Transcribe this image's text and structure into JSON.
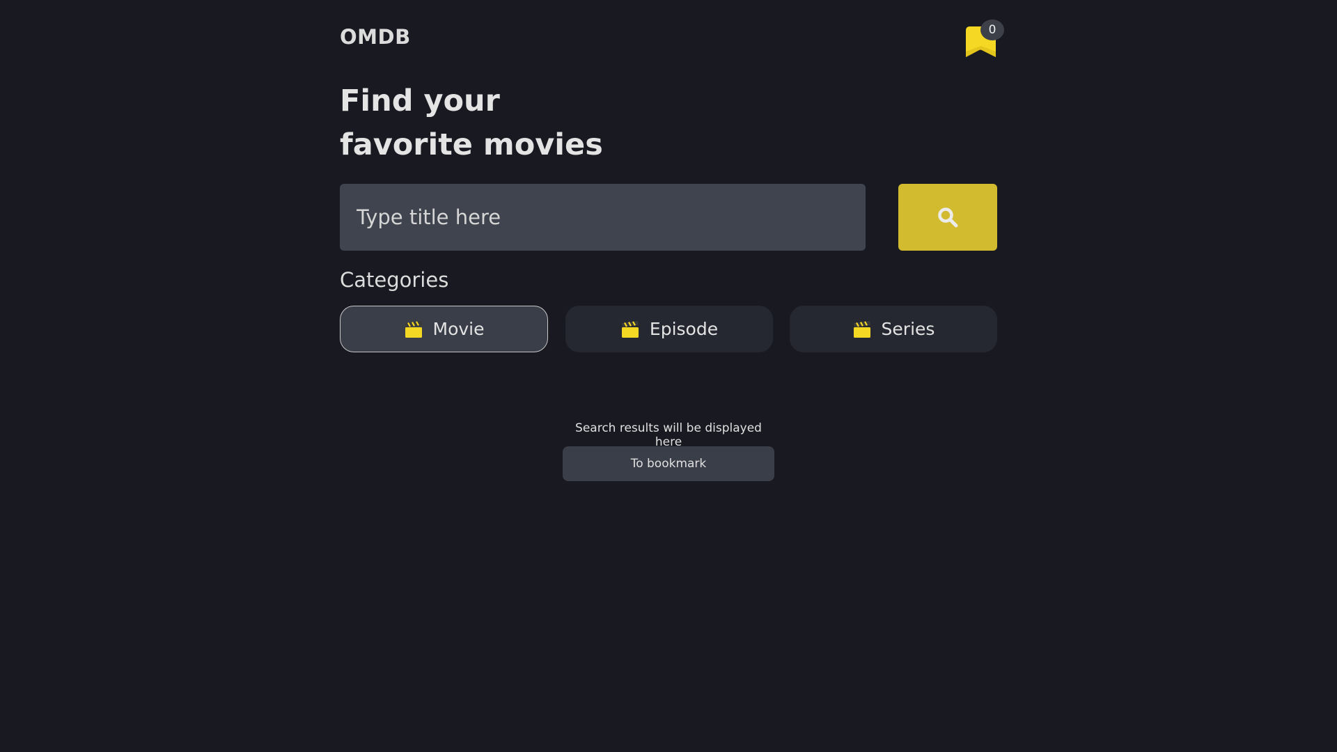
{
  "header": {
    "logo": "OMDB",
    "bookmark_count": "0"
  },
  "hero": {
    "headline": "Find your\nfavorite movies"
  },
  "search": {
    "placeholder": "Type title here",
    "value": ""
  },
  "categories": {
    "title": "Categories",
    "items": [
      {
        "label": "Movie",
        "icon": "clapperboard-icon",
        "active": true
      },
      {
        "label": "Episode",
        "icon": "clapperboard-icon",
        "active": false
      },
      {
        "label": "Series",
        "icon": "clapperboard-icon",
        "active": false
      }
    ]
  },
  "results": {
    "message": "Search results will be displayed here",
    "to_bookmark_label": "To bookmark"
  },
  "colors": {
    "background": "#191922",
    "accent": "#d2bb2f",
    "bookmark_yellow": "#f5d824",
    "input_bg": "#3f444e"
  }
}
